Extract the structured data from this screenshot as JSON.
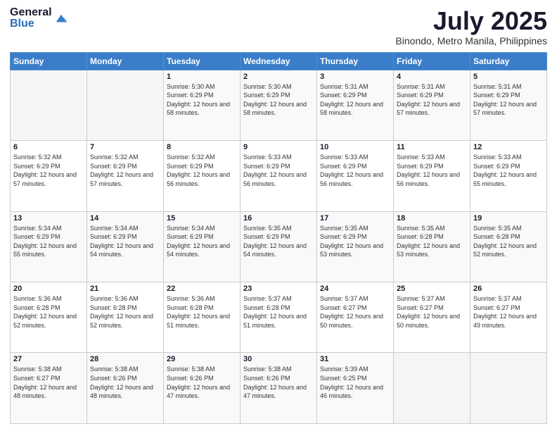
{
  "logo": {
    "general": "General",
    "blue": "Blue"
  },
  "title": "July 2025",
  "subtitle": "Binondo, Metro Manila, Philippines",
  "days_of_week": [
    "Sunday",
    "Monday",
    "Tuesday",
    "Wednesday",
    "Thursday",
    "Friday",
    "Saturday"
  ],
  "weeks": [
    [
      {
        "day": "",
        "sunrise": "",
        "sunset": "",
        "daylight": ""
      },
      {
        "day": "",
        "sunrise": "",
        "sunset": "",
        "daylight": ""
      },
      {
        "day": "1",
        "sunrise": "Sunrise: 5:30 AM",
        "sunset": "Sunset: 6:29 PM",
        "daylight": "Daylight: 12 hours and 58 minutes."
      },
      {
        "day": "2",
        "sunrise": "Sunrise: 5:30 AM",
        "sunset": "Sunset: 6:29 PM",
        "daylight": "Daylight: 12 hours and 58 minutes."
      },
      {
        "day": "3",
        "sunrise": "Sunrise: 5:31 AM",
        "sunset": "Sunset: 6:29 PM",
        "daylight": "Daylight: 12 hours and 58 minutes."
      },
      {
        "day": "4",
        "sunrise": "Sunrise: 5:31 AM",
        "sunset": "Sunset: 6:29 PM",
        "daylight": "Daylight: 12 hours and 57 minutes."
      },
      {
        "day": "5",
        "sunrise": "Sunrise: 5:31 AM",
        "sunset": "Sunset: 6:29 PM",
        "daylight": "Daylight: 12 hours and 57 minutes."
      }
    ],
    [
      {
        "day": "6",
        "sunrise": "Sunrise: 5:32 AM",
        "sunset": "Sunset: 6:29 PM",
        "daylight": "Daylight: 12 hours and 57 minutes."
      },
      {
        "day": "7",
        "sunrise": "Sunrise: 5:32 AM",
        "sunset": "Sunset: 6:29 PM",
        "daylight": "Daylight: 12 hours and 57 minutes."
      },
      {
        "day": "8",
        "sunrise": "Sunrise: 5:32 AM",
        "sunset": "Sunset: 6:29 PM",
        "daylight": "Daylight: 12 hours and 56 minutes."
      },
      {
        "day": "9",
        "sunrise": "Sunrise: 5:33 AM",
        "sunset": "Sunset: 6:29 PM",
        "daylight": "Daylight: 12 hours and 56 minutes."
      },
      {
        "day": "10",
        "sunrise": "Sunrise: 5:33 AM",
        "sunset": "Sunset: 6:29 PM",
        "daylight": "Daylight: 12 hours and 56 minutes."
      },
      {
        "day": "11",
        "sunrise": "Sunrise: 5:33 AM",
        "sunset": "Sunset: 6:29 PM",
        "daylight": "Daylight: 12 hours and 56 minutes."
      },
      {
        "day": "12",
        "sunrise": "Sunrise: 5:33 AM",
        "sunset": "Sunset: 6:29 PM",
        "daylight": "Daylight: 12 hours and 55 minutes."
      }
    ],
    [
      {
        "day": "13",
        "sunrise": "Sunrise: 5:34 AM",
        "sunset": "Sunset: 6:29 PM",
        "daylight": "Daylight: 12 hours and 55 minutes."
      },
      {
        "day": "14",
        "sunrise": "Sunrise: 5:34 AM",
        "sunset": "Sunset: 6:29 PM",
        "daylight": "Daylight: 12 hours and 54 minutes."
      },
      {
        "day": "15",
        "sunrise": "Sunrise: 5:34 AM",
        "sunset": "Sunset: 6:29 PM",
        "daylight": "Daylight: 12 hours and 54 minutes."
      },
      {
        "day": "16",
        "sunrise": "Sunrise: 5:35 AM",
        "sunset": "Sunset: 6:29 PM",
        "daylight": "Daylight: 12 hours and 54 minutes."
      },
      {
        "day": "17",
        "sunrise": "Sunrise: 5:35 AM",
        "sunset": "Sunset: 6:29 PM",
        "daylight": "Daylight: 12 hours and 53 minutes."
      },
      {
        "day": "18",
        "sunrise": "Sunrise: 5:35 AM",
        "sunset": "Sunset: 6:28 PM",
        "daylight": "Daylight: 12 hours and 53 minutes."
      },
      {
        "day": "19",
        "sunrise": "Sunrise: 5:35 AM",
        "sunset": "Sunset: 6:28 PM",
        "daylight": "Daylight: 12 hours and 52 minutes."
      }
    ],
    [
      {
        "day": "20",
        "sunrise": "Sunrise: 5:36 AM",
        "sunset": "Sunset: 6:28 PM",
        "daylight": "Daylight: 12 hours and 52 minutes."
      },
      {
        "day": "21",
        "sunrise": "Sunrise: 5:36 AM",
        "sunset": "Sunset: 6:28 PM",
        "daylight": "Daylight: 12 hours and 52 minutes."
      },
      {
        "day": "22",
        "sunrise": "Sunrise: 5:36 AM",
        "sunset": "Sunset: 6:28 PM",
        "daylight": "Daylight: 12 hours and 51 minutes."
      },
      {
        "day": "23",
        "sunrise": "Sunrise: 5:37 AM",
        "sunset": "Sunset: 6:28 PM",
        "daylight": "Daylight: 12 hours and 51 minutes."
      },
      {
        "day": "24",
        "sunrise": "Sunrise: 5:37 AM",
        "sunset": "Sunset: 6:27 PM",
        "daylight": "Daylight: 12 hours and 50 minutes."
      },
      {
        "day": "25",
        "sunrise": "Sunrise: 5:37 AM",
        "sunset": "Sunset: 6:27 PM",
        "daylight": "Daylight: 12 hours and 50 minutes."
      },
      {
        "day": "26",
        "sunrise": "Sunrise: 5:37 AM",
        "sunset": "Sunset: 6:27 PM",
        "daylight": "Daylight: 12 hours and 49 minutes."
      }
    ],
    [
      {
        "day": "27",
        "sunrise": "Sunrise: 5:38 AM",
        "sunset": "Sunset: 6:27 PM",
        "daylight": "Daylight: 12 hours and 48 minutes."
      },
      {
        "day": "28",
        "sunrise": "Sunrise: 5:38 AM",
        "sunset": "Sunset: 6:26 PM",
        "daylight": "Daylight: 12 hours and 48 minutes."
      },
      {
        "day": "29",
        "sunrise": "Sunrise: 5:38 AM",
        "sunset": "Sunset: 6:26 PM",
        "daylight": "Daylight: 12 hours and 47 minutes."
      },
      {
        "day": "30",
        "sunrise": "Sunrise: 5:38 AM",
        "sunset": "Sunset: 6:26 PM",
        "daylight": "Daylight: 12 hours and 47 minutes."
      },
      {
        "day": "31",
        "sunrise": "Sunrise: 5:39 AM",
        "sunset": "Sunset: 6:25 PM",
        "daylight": "Daylight: 12 hours and 46 minutes."
      },
      {
        "day": "",
        "sunrise": "",
        "sunset": "",
        "daylight": ""
      },
      {
        "day": "",
        "sunrise": "",
        "sunset": "",
        "daylight": ""
      }
    ]
  ]
}
